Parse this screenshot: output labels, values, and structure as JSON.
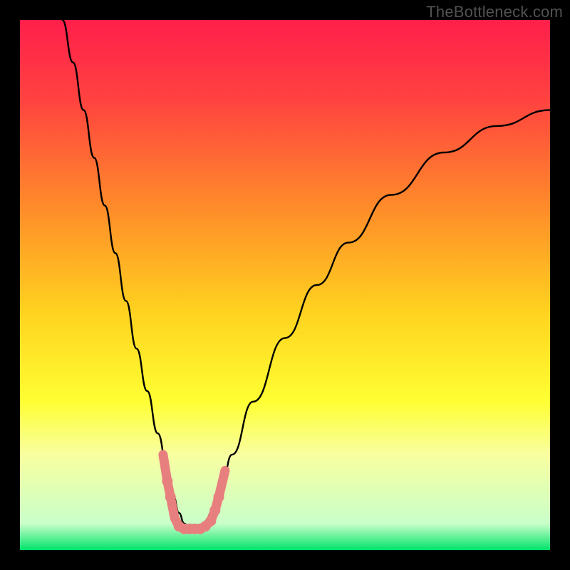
{
  "watermark": "TheBottleneck.com",
  "chart_data": {
    "type": "line",
    "title": "",
    "xlabel": "",
    "ylabel": "",
    "xlim": [
      0,
      100
    ],
    "ylim": [
      0,
      100
    ],
    "grid": false,
    "legend": false,
    "background_gradient": {
      "stops": [
        {
          "offset": 0.0,
          "color": "#ff1f4b"
        },
        {
          "offset": 0.15,
          "color": "#ff4240"
        },
        {
          "offset": 0.35,
          "color": "#ff8a2a"
        },
        {
          "offset": 0.55,
          "color": "#ffd21f"
        },
        {
          "offset": 0.72,
          "color": "#ffff33"
        },
        {
          "offset": 0.82,
          "color": "#f8ffa0"
        },
        {
          "offset": 0.95,
          "color": "#c9ffc9"
        },
        {
          "offset": 1.0,
          "color": "#00e36a"
        }
      ]
    },
    "series": [
      {
        "name": "bottleneck-curve",
        "x": [
          8,
          10,
          12,
          14,
          16,
          18,
          20,
          22,
          24,
          26,
          28,
          29,
          30,
          31,
          32,
          33,
          34,
          35,
          36,
          38,
          40,
          44,
          50,
          56,
          62,
          70,
          80,
          90,
          100
        ],
        "y": [
          100,
          92,
          83,
          74,
          65,
          56,
          47,
          38,
          30,
          22,
          14,
          10,
          7,
          5,
          4,
          4,
          4,
          5,
          7,
          12,
          18,
          28,
          40,
          50,
          58,
          67,
          75,
          80,
          83
        ]
      }
    ],
    "markers": {
      "name": "highlight-dots",
      "color": "#e77f7e",
      "points": [
        {
          "x": 27.0,
          "y": 18,
          "r": 4
        },
        {
          "x": 27.8,
          "y": 13,
          "r": 5
        },
        {
          "x": 28.4,
          "y": 10,
          "r": 5
        },
        {
          "x": 29.2,
          "y": 6,
          "r": 4
        },
        {
          "x": 30.0,
          "y": 4.5,
          "r": 5
        },
        {
          "x": 31.0,
          "y": 4,
          "r": 5
        },
        {
          "x": 32.0,
          "y": 4,
          "r": 5
        },
        {
          "x": 33.0,
          "y": 4,
          "r": 5
        },
        {
          "x": 34.0,
          "y": 4,
          "r": 5
        },
        {
          "x": 35.0,
          "y": 4.5,
          "r": 5
        },
        {
          "x": 36.0,
          "y": 5.5,
          "r": 5
        },
        {
          "x": 36.8,
          "y": 7.5,
          "r": 5
        },
        {
          "x": 37.5,
          "y": 10,
          "r": 5
        },
        {
          "x": 38.7,
          "y": 15,
          "r": 4
        }
      ]
    }
  }
}
